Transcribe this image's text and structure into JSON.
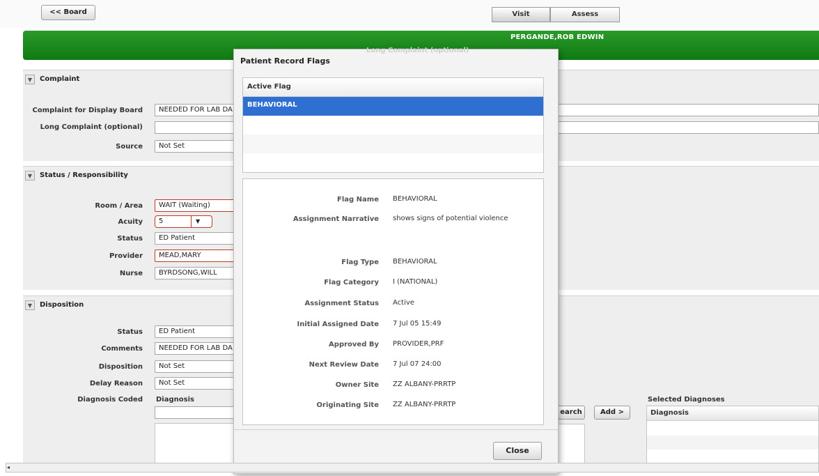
{
  "toolbar": {
    "board_button": "<< Board",
    "visit_tab": "Visit",
    "assess_tab": "Assess"
  },
  "banner": {
    "patient_name": "PERGANDE,ROB EDWIN"
  },
  "complaint": {
    "title": "Complaint",
    "display_board_label": "Complaint for Display Board",
    "display_board_value": "NEEDED FOR LAB DA",
    "long_label": "Long Complaint (optional)",
    "long_value": "",
    "source_label": "Source",
    "source_value": "Not Set"
  },
  "status": {
    "title": "Status / Responsibility",
    "room_label": "Room / Area",
    "room_value": "WAIT  (Waiting)",
    "acuity_label": "Acuity",
    "acuity_value": "5",
    "status_label": "Status",
    "status_value": "ED Patient",
    "provider_label": "Provider",
    "provider_value": "MEAD,MARY",
    "nurse_label": "Nurse",
    "nurse_value": "BYRDSONG,WILL"
  },
  "disposition": {
    "title": "Disposition",
    "status_label": "Status",
    "status_value": "ED Patient",
    "comments_label": "Comments",
    "comments_value": "NEEDED FOR LAB DA",
    "disposition_label": "Disposition",
    "disposition_value": "Not Set",
    "delay_label": "Delay Reason",
    "delay_value": "Not Set",
    "diagnosis_coded_label": "Diagnosis Coded",
    "diagnosis_col": "Diagnosis",
    "search_button": "earch",
    "add_button": "Add >",
    "selected_title": "Selected Diagnoses",
    "selected_col": "Diagnosis"
  },
  "modal": {
    "title": "Patient Record Flags",
    "ghost_text": "Long Complaint (optional)",
    "list_header": "Active Flag",
    "flags": [
      "BEHAVIORAL"
    ],
    "details": [
      {
        "label": "Flag Name",
        "value": "BEHAVIORAL"
      },
      {
        "label": "Assignment Narrative",
        "value": "shows signs of potential violence"
      },
      {
        "label": "Flag Type",
        "value": "BEHAVIORAL"
      },
      {
        "label": "Flag Category",
        "value": "I (NATIONAL)"
      },
      {
        "label": "Assignment Status",
        "value": "Active"
      },
      {
        "label": "Initial Assigned Date",
        "value": "7 Jul 05 15:49"
      },
      {
        "label": "Approved By",
        "value": "PROVIDER,PRF"
      },
      {
        "label": "Next Review Date",
        "value": "7 Jul 07 24:00"
      },
      {
        "label": "Owner Site",
        "value": "ZZ ALBANY-PRRTP"
      },
      {
        "label": "Originating Site",
        "value": "ZZ ALBANY-PRRTP"
      }
    ],
    "close_button": "Close"
  },
  "colors": {
    "banner_green": "#1a8a1c",
    "selection_blue": "#2f6fd1",
    "required_red": "#c0392b"
  }
}
